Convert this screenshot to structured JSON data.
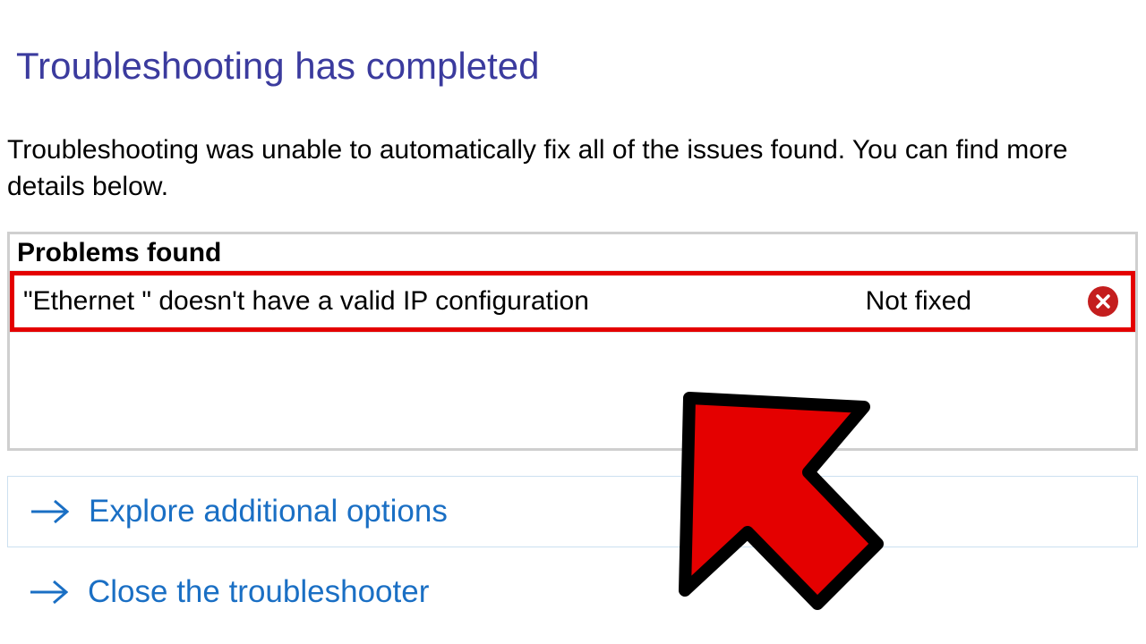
{
  "header": {
    "title": "Troubleshooting has completed"
  },
  "body": {
    "description": "Troubleshooting was unable to automatically fix all of the issues found. You can find more details below."
  },
  "problems": {
    "table_header": "Problems found",
    "rows": [
      {
        "description": "\"Ethernet \" doesn't have a valid IP configuration",
        "status": "Not fixed",
        "icon": "error"
      }
    ]
  },
  "actions": {
    "explore": "Explore additional options",
    "close": "Close the troubleshooter"
  },
  "colors": {
    "title_color": "#3b3b9e",
    "link_color": "#1a6fc4",
    "highlight_red": "#e40000",
    "error_icon": "#c41e1e"
  }
}
